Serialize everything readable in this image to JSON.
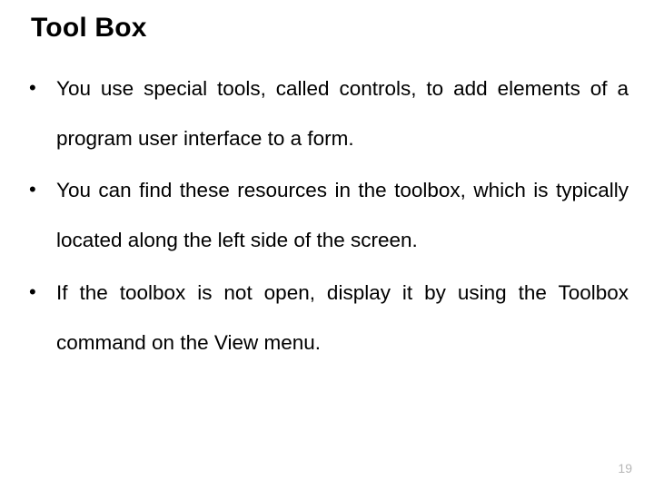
{
  "title": "Tool Box",
  "bullets": [
    "You use special tools, called controls, to add elements of a program user interface to a form.",
    "You can find these resources in the toolbox, which is typically located along the left side of the screen.",
    "If the toolbox is not open, display it by using the Toolbox command on the View menu."
  ],
  "page_number": "19"
}
